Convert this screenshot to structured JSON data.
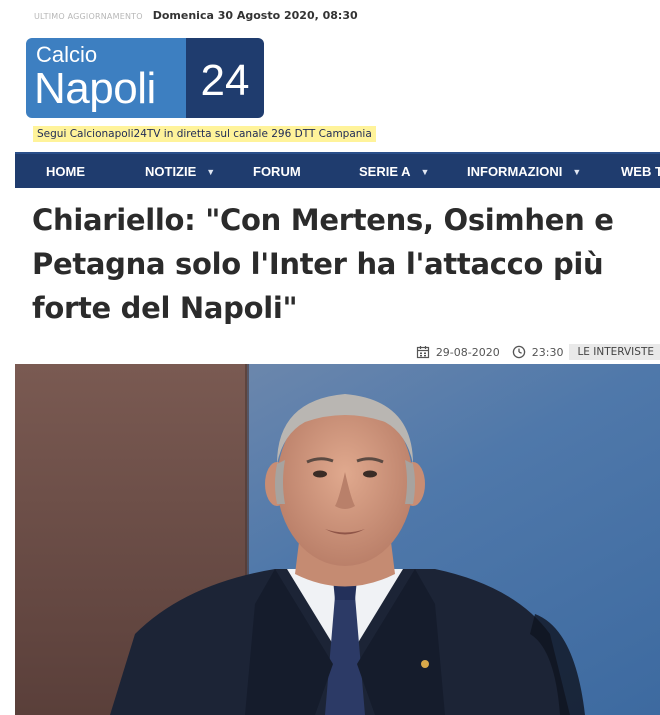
{
  "topbar": {
    "label": "ULTIMO AGGIORNAMENTO",
    "datetime": "Domenica 30 Agosto 2020, 08:30"
  },
  "logo": {
    "line1": "Calcio",
    "line2": "Napoli",
    "number": "24"
  },
  "tv_banner": "Segui Calcionapoli24TV in diretta sul canale 296 DTT Campania",
  "nav": {
    "items": [
      {
        "label": "HOME",
        "dropdown": false
      },
      {
        "label": "NOTIZIE",
        "dropdown": true
      },
      {
        "label": "FORUM",
        "dropdown": false
      },
      {
        "label": "SERIE A",
        "dropdown": true
      },
      {
        "label": "INFORMAZIONI",
        "dropdown": true
      },
      {
        "label": "WEB T",
        "dropdown": false
      }
    ]
  },
  "article": {
    "title_lines": [
      "Chiariello: \"Con Mertens, Osimhen e",
      "Petagna solo l'Inter ha l'attacco più",
      "forte del Napoli\""
    ],
    "date": "29-08-2020",
    "time": "23:30",
    "category": "LE INTERVISTE"
  },
  "colors": {
    "nav_bg": "#1f3c6e",
    "logo_light": "#3d7fc1",
    "logo_dark": "#1f3c6e",
    "banner_highlight": "#fff39a"
  },
  "icons": {
    "date": "calendar-icon",
    "time": "clock-icon"
  }
}
